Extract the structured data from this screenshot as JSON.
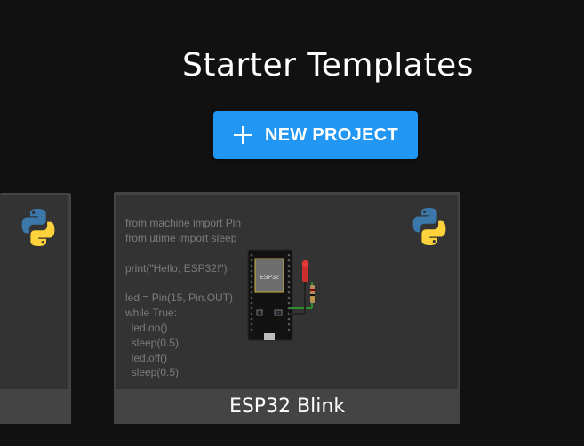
{
  "page": {
    "heading": "Starter Templates",
    "new_project_label": "NEW PROJECT"
  },
  "cards": {
    "left": {
      "title": ""
    },
    "main": {
      "title": "ESP32 Blink",
      "board_label": "ESP32",
      "code_lines": [
        "from machine import Pin",
        "from utime import sleep",
        "",
        "print(\"Hello, ESP32!\")",
        "",
        "led = Pin(15, Pin.OUT)",
        "while True:",
        "  led.on()",
        "  sleep(0.5)",
        "  led.off()",
        "  sleep(0.5)"
      ]
    }
  },
  "icons": {
    "add": "plus-icon",
    "language": "python-logo-icon"
  },
  "colors": {
    "background": "#111111",
    "accent": "#2196f3",
    "card": "#444444",
    "card_preview": "#333333",
    "code_text": "#7c7c7c"
  }
}
